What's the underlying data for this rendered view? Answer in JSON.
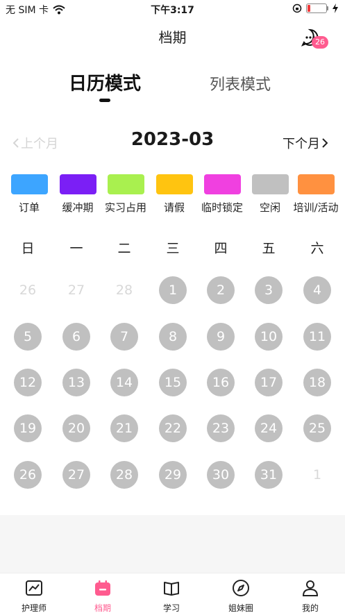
{
  "status_bar": {
    "carrier": "无 SIM 卡",
    "time": "下午3:17"
  },
  "header": {
    "title": "档期",
    "message_badge": "26"
  },
  "tabs": {
    "calendar": "日历模式",
    "list": "列表模式",
    "active": "calendar"
  },
  "month_nav": {
    "prev": "上个月",
    "current": "2023-03",
    "next": "下个月"
  },
  "legend": [
    {
      "label": "订单",
      "color": "#3da5ff"
    },
    {
      "label": "缓冲期",
      "color": "#7b1ff5"
    },
    {
      "label": "实习占用",
      "color": "#a9f04f"
    },
    {
      "label": "请假",
      "color": "#ffc410"
    },
    {
      "label": "临时锁定",
      "color": "#f040e0"
    },
    {
      "label": "空闲",
      "color": "#c0c0c0"
    },
    {
      "label": "培训/活动",
      "color": "#ff9140"
    }
  ],
  "weekdays": [
    "日",
    "一",
    "二",
    "三",
    "四",
    "五",
    "六"
  ],
  "calendar": {
    "rows": [
      [
        {
          "d": "26",
          "in": false
        },
        {
          "d": "27",
          "in": false
        },
        {
          "d": "28",
          "in": false
        },
        {
          "d": "1",
          "in": true
        },
        {
          "d": "2",
          "in": true
        },
        {
          "d": "3",
          "in": true
        },
        {
          "d": "4",
          "in": true
        }
      ],
      [
        {
          "d": "5",
          "in": true
        },
        {
          "d": "6",
          "in": true
        },
        {
          "d": "7",
          "in": true
        },
        {
          "d": "8",
          "in": true
        },
        {
          "d": "9",
          "in": true
        },
        {
          "d": "10",
          "in": true
        },
        {
          "d": "11",
          "in": true
        }
      ],
      [
        {
          "d": "12",
          "in": true
        },
        {
          "d": "13",
          "in": true
        },
        {
          "d": "14",
          "in": true
        },
        {
          "d": "15",
          "in": true
        },
        {
          "d": "16",
          "in": true
        },
        {
          "d": "17",
          "in": true
        },
        {
          "d": "18",
          "in": true
        }
      ],
      [
        {
          "d": "19",
          "in": true
        },
        {
          "d": "20",
          "in": true
        },
        {
          "d": "21",
          "in": true
        },
        {
          "d": "22",
          "in": true
        },
        {
          "d": "23",
          "in": true
        },
        {
          "d": "24",
          "in": true
        },
        {
          "d": "25",
          "in": true
        }
      ],
      [
        {
          "d": "26",
          "in": true
        },
        {
          "d": "27",
          "in": true
        },
        {
          "d": "28",
          "in": true
        },
        {
          "d": "29",
          "in": true
        },
        {
          "d": "30",
          "in": true
        },
        {
          "d": "31",
          "in": true
        },
        {
          "d": "1",
          "in": false
        }
      ]
    ]
  },
  "tabbar": [
    {
      "label": "护理师",
      "icon": "trend-chart-icon"
    },
    {
      "label": "档期",
      "icon": "calendar-icon",
      "active": true
    },
    {
      "label": "学习",
      "icon": "book-icon"
    },
    {
      "label": "姐妹圈",
      "icon": "compass-icon"
    },
    {
      "label": "我的",
      "icon": "user-icon"
    }
  ],
  "colors": {
    "accent": "#ff5b8f",
    "free_day": "#c0c0c0"
  }
}
